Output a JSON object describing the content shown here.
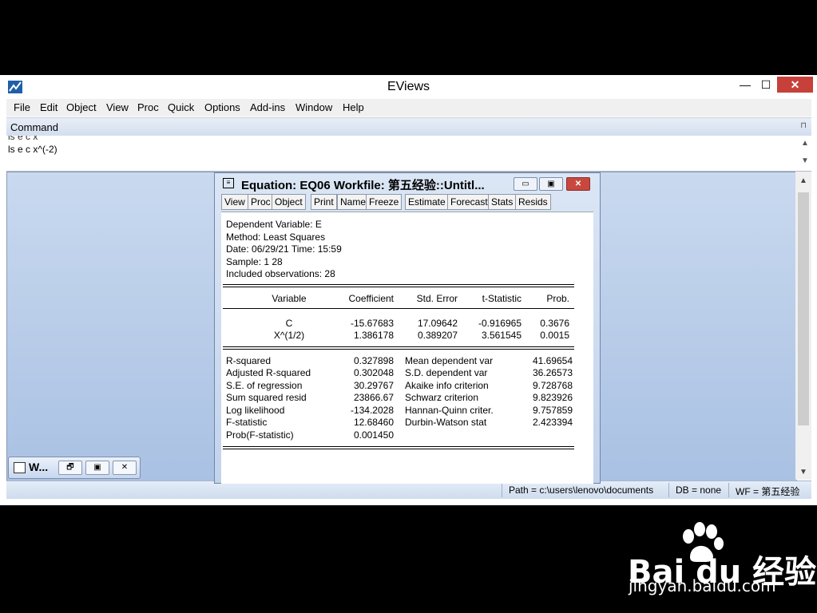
{
  "app": {
    "title": "EViews",
    "window_controls": {
      "minimize": "—",
      "maximize": "☐",
      "close": "✕"
    }
  },
  "menu": [
    "File",
    "Edit",
    "Object",
    "View",
    "Proc",
    "Quick",
    "Options",
    "Add-ins",
    "Window",
    "Help"
  ],
  "command": {
    "title": "Command",
    "pin": "⊓",
    "lines": [
      "ls e c x",
      "ls e c x^(-2)"
    ]
  },
  "scroll": {
    "up": "▲",
    "down": "▼"
  },
  "minimized_window": {
    "title": "W...",
    "buttons": [
      "🗗",
      "▣",
      "✕"
    ]
  },
  "equation_window": {
    "title": "Equation: EQ06   Workfile: 第五经验::Untitl...",
    "sys_icon": "≡",
    "buttons": {
      "minimize": "▭",
      "restore": "▣",
      "close": "✕"
    },
    "toolbar": [
      "View",
      "Proc",
      "Object",
      "Print",
      "Name",
      "Freeze",
      "Estimate",
      "Forecast",
      "Stats",
      "Resids"
    ],
    "header_lines": [
      "Dependent Variable: E",
      "Method: Least Squares",
      "Date: 06/29/21   Time: 15:59",
      "Sample: 1 28",
      "Included observations: 28"
    ],
    "coef_columns": [
      "Variable",
      "Coefficient",
      "Std. Error",
      "t-Statistic",
      "Prob."
    ],
    "coef_rows": [
      [
        "C",
        "-15.67683",
        "17.09642",
        "-0.916965",
        "0.3676"
      ],
      [
        "X^(1/2)",
        "1.386178",
        "0.389207",
        "3.561545",
        "0.0015"
      ]
    ],
    "stats_left": [
      [
        "R-squared",
        "0.327898"
      ],
      [
        "Adjusted R-squared",
        "0.302048"
      ],
      [
        "S.E. of regression",
        "30.29767"
      ],
      [
        "Sum squared resid",
        "23866.67"
      ],
      [
        "Log likelihood",
        "-134.2028"
      ],
      [
        "F-statistic",
        "12.68460"
      ],
      [
        "Prob(F-statistic)",
        "0.001450"
      ]
    ],
    "stats_right": [
      [
        "Mean dependent var",
        "41.69654"
      ],
      [
        "S.D. dependent var",
        "36.26573"
      ],
      [
        "Akaike info criterion",
        "9.728768"
      ],
      [
        "Schwarz criterion",
        "9.823926"
      ],
      [
        "Hannan-Quinn criter.",
        "9.757859"
      ],
      [
        "Durbin-Watson stat",
        "2.423394"
      ]
    ]
  },
  "status": {
    "path": "Path = c:\\users\\lenovo\\documents",
    "db": "DB = none",
    "wf": "WF = 第五经验"
  },
  "watermark": {
    "brand": "Bai du 经验",
    "url": "jingyan.baidu.com"
  }
}
